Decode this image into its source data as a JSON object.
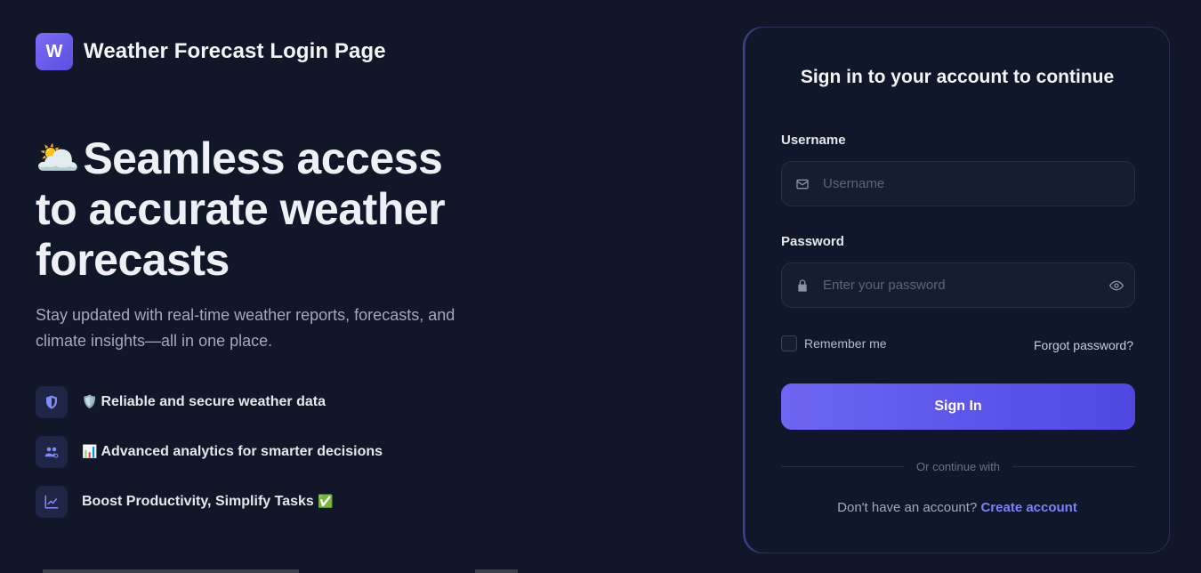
{
  "brand": {
    "logo_letter": "W",
    "title": "Weather Forecast Login Page"
  },
  "hero": {
    "emoji": "🌥️",
    "title": "Seamless access to accurate weather forecasts",
    "subtitle": "Stay updated with real-time weather reports, forecasts, and climate insights—all in one place."
  },
  "features": [
    {
      "icon": "shield-icon",
      "emoji": "🛡️",
      "text": "Reliable and secure weather data"
    },
    {
      "icon": "users-icon",
      "emoji": "📊",
      "text": "Advanced analytics for smarter decisions"
    },
    {
      "icon": "chart-line-icon",
      "emoji": "✅",
      "text": "Boost Productivity, Simplify Tasks"
    }
  ],
  "form": {
    "title": "Sign in to your account to continue",
    "username_label": "Username",
    "username_placeholder": "Username",
    "password_label": "Password",
    "password_placeholder": "Enter your password",
    "remember_label": "Remember me",
    "forgot_label": "Forgot password?",
    "signin_label": "Sign In",
    "divider_text": "Or continue with",
    "signup_prompt": "Don't have an account?",
    "signup_link": "Create account"
  },
  "colors": {
    "accent": "#6366f1",
    "background": "#111729",
    "card": "#10172a"
  }
}
